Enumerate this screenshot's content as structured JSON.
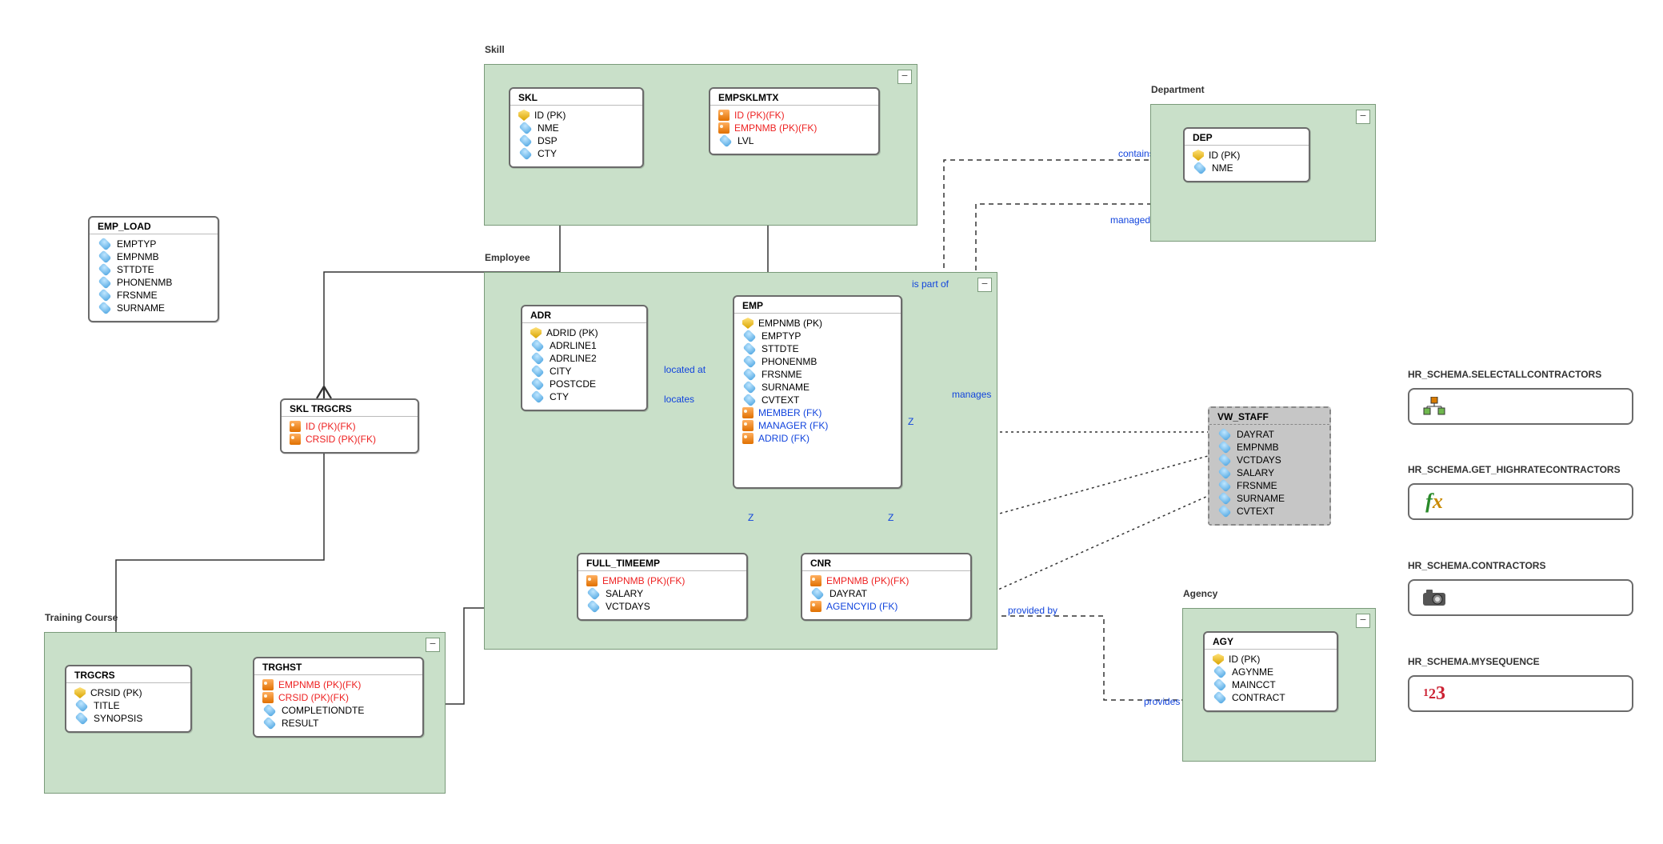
{
  "groups": {
    "skill": {
      "title": "Skill"
    },
    "employee": {
      "title": "Employee"
    },
    "department": {
      "title": "Department"
    },
    "training": {
      "title": "Training Course"
    },
    "agency": {
      "title": "Agency"
    }
  },
  "entities": {
    "emp_load": {
      "name": "EMP_LOAD",
      "cols": [
        {
          "n": "EMPTYP",
          "t": "col"
        },
        {
          "n": "EMPNMB",
          "t": "col"
        },
        {
          "n": "STTDTE",
          "t": "col"
        },
        {
          "n": "PHONENMB",
          "t": "col"
        },
        {
          "n": "FRSNME",
          "t": "col"
        },
        {
          "n": "SURNAME",
          "t": "col"
        }
      ]
    },
    "skl": {
      "name": "SKL",
      "cols": [
        {
          "n": "ID (PK)",
          "t": "pk"
        },
        {
          "n": "NME",
          "t": "col"
        },
        {
          "n": "DSP",
          "t": "col"
        },
        {
          "n": "CTY",
          "t": "col"
        }
      ]
    },
    "empsklmtx": {
      "name": "EMPSKLMTX",
      "cols": [
        {
          "n": "ID (PK)(FK)",
          "t": "fk",
          "c": "red"
        },
        {
          "n": "EMPNMB (PK)(FK)",
          "t": "fk",
          "c": "red"
        },
        {
          "n": "LVL",
          "t": "col"
        }
      ]
    },
    "skl_trgcrs": {
      "name": "SKL TRGCRS",
      "cols": [
        {
          "n": "ID (PK)(FK)",
          "t": "fk",
          "c": "red"
        },
        {
          "n": "CRSID (PK)(FK)",
          "t": "fk",
          "c": "red"
        }
      ]
    },
    "adr": {
      "name": "ADR",
      "cols": [
        {
          "n": "ADRID (PK)",
          "t": "pk"
        },
        {
          "n": "ADRLINE1",
          "t": "col"
        },
        {
          "n": "ADRLINE2",
          "t": "col"
        },
        {
          "n": "CITY",
          "t": "col"
        },
        {
          "n": "POSTCDE",
          "t": "col"
        },
        {
          "n": "CTY",
          "t": "col"
        }
      ]
    },
    "emp": {
      "name": "EMP",
      "cols": [
        {
          "n": "EMPNMB (PK)",
          "t": "pk"
        },
        {
          "n": "EMPTYP",
          "t": "col"
        },
        {
          "n": "STTDTE",
          "t": "col"
        },
        {
          "n": "PHONENMB",
          "t": "col"
        },
        {
          "n": "FRSNME",
          "t": "col"
        },
        {
          "n": "SURNAME",
          "t": "col"
        },
        {
          "n": "CVTEXT",
          "t": "col"
        },
        {
          "n": "MEMBER (FK)",
          "t": "fk",
          "c": "blue"
        },
        {
          "n": "MANAGER (FK)",
          "t": "fk",
          "c": "blue"
        },
        {
          "n": "ADRID (FK)",
          "t": "fk",
          "c": "blue"
        }
      ]
    },
    "full_timeemp": {
      "name": "FULL_TIMEEMP",
      "cols": [
        {
          "n": "EMPNMB (PK)(FK)",
          "t": "fk",
          "c": "red"
        },
        {
          "n": "SALARY",
          "t": "col"
        },
        {
          "n": "VCTDAYS",
          "t": "col"
        }
      ]
    },
    "cnr": {
      "name": "CNR",
      "cols": [
        {
          "n": "EMPNMB (PK)(FK)",
          "t": "fk",
          "c": "red"
        },
        {
          "n": "DAYRAT",
          "t": "col"
        },
        {
          "n": "AGENCYID (FK)",
          "t": "fk",
          "c": "blue"
        }
      ]
    },
    "trgcrs": {
      "name": "TRGCRS",
      "cols": [
        {
          "n": "CRSID (PK)",
          "t": "pk"
        },
        {
          "n": "TITLE",
          "t": "col"
        },
        {
          "n": "SYNOPSIS",
          "t": "col"
        }
      ]
    },
    "trghst": {
      "name": "TRGHST",
      "cols": [
        {
          "n": "EMPNMB (PK)(FK)",
          "t": "fk",
          "c": "red"
        },
        {
          "n": "CRSID (PK)(FK)",
          "t": "fk",
          "c": "red"
        },
        {
          "n": "COMPLETIONDTE",
          "t": "col"
        },
        {
          "n": "RESULT",
          "t": "col"
        }
      ]
    },
    "dep": {
      "name": "DEP",
      "cols": [
        {
          "n": "ID (PK)",
          "t": "pk"
        },
        {
          "n": "NME",
          "t": "col"
        }
      ]
    },
    "agy": {
      "name": "AGY",
      "cols": [
        {
          "n": "ID (PK)",
          "t": "pk"
        },
        {
          "n": "AGYNME",
          "t": "col"
        },
        {
          "n": "MAINCCT",
          "t": "col"
        },
        {
          "n": "CONTRACT",
          "t": "col"
        }
      ]
    },
    "vw_staff": {
      "name": "VW_STAFF",
      "cols": [
        {
          "n": "DAYRAT",
          "t": "col"
        },
        {
          "n": "EMPNMB",
          "t": "col"
        },
        {
          "n": "VCTDAYS",
          "t": "col"
        },
        {
          "n": "SALARY",
          "t": "col"
        },
        {
          "n": "FRSNME",
          "t": "col"
        },
        {
          "n": "SURNAME",
          "t": "col"
        },
        {
          "n": "CVTEXT",
          "t": "col"
        }
      ]
    }
  },
  "relLabels": {
    "is_part_of": "is part of",
    "contains": "contains",
    "managed_by": "managed by",
    "manages": "manages",
    "located_at": "located at",
    "locates": "locates",
    "provided_by": "provided by",
    "provides": "provides"
  },
  "z_labels": {
    "z1": "Z",
    "z2": "Z",
    "z3": "Z"
  },
  "schema": {
    "proc": {
      "title": "HR_SCHEMA.SELECTALLCONTRACTORS"
    },
    "func": {
      "title": "HR_SCHEMA.GET_HIGHRATECONTRACTORS"
    },
    "snap": {
      "title": "HR_SCHEMA.CONTRACTORS"
    },
    "seq": {
      "title": "HR_SCHEMA.MYSEQUENCE"
    }
  }
}
